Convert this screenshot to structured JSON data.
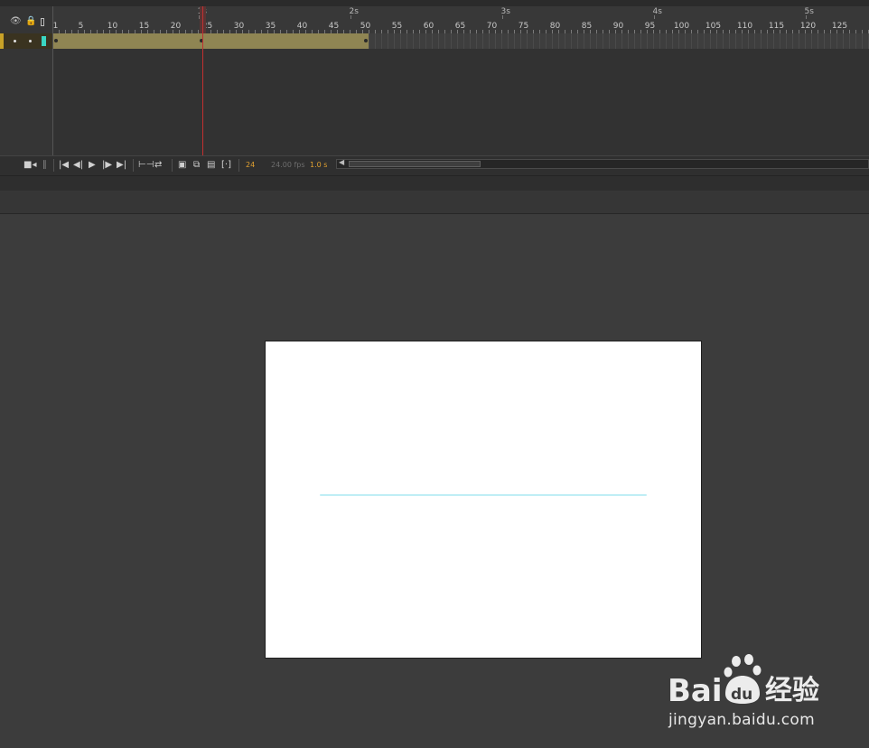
{
  "timeline": {
    "second_markers": [
      "1s",
      "2s",
      "3s",
      "4s",
      "5s"
    ],
    "frame_numbers": [
      "1",
      "5",
      "10",
      "15",
      "20",
      "25",
      "30",
      "35",
      "40",
      "45",
      "50",
      "55",
      "60",
      "65",
      "70",
      "75",
      "80",
      "85",
      "90",
      "95",
      "100",
      "105",
      "110",
      "115",
      "120",
      "125"
    ],
    "current_frame": "24",
    "fps": "24.00 fps",
    "elapsed": "1.0 s",
    "tween_end_frame": 50,
    "playhead_frame": 24,
    "header_icons": [
      "eye-icon",
      "lock-icon",
      "outline-icon"
    ],
    "layer_color": "#3ad6c2",
    "tween_color": "#8f8553"
  },
  "controls": {
    "icons": [
      "camera-icon",
      "pin-icon",
      "first-frame-icon",
      "step-back-icon",
      "play-icon",
      "step-forward-icon",
      "last-frame-icon",
      "center-frame-icon",
      "loop-icon",
      "onion-skin-icon",
      "onion-outline-icon",
      "edit-multiple-icon",
      "onion-markers-icon"
    ]
  },
  "stage": {
    "background": "#ffffff",
    "line_color": "#bfeef5"
  },
  "watermark": {
    "logo": "Bai du 经验",
    "url": "jingyan.baidu.com"
  }
}
